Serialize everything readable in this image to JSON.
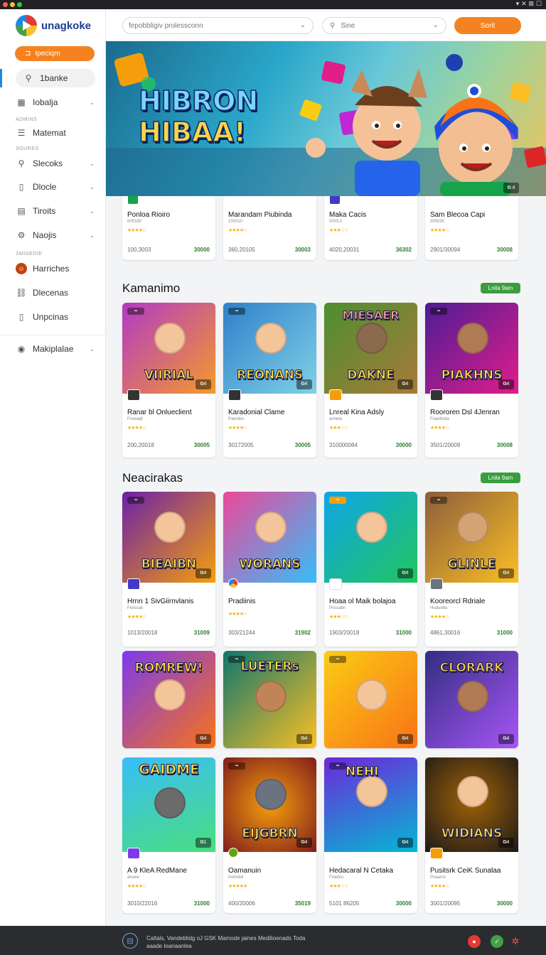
{
  "window": {
    "right_icons": "▾ ✕ ⊠ ☐"
  },
  "app": {
    "name": "unagkoke"
  },
  "sidebar": {
    "cta_label": "Ipeciqm",
    "active_label": "1banke",
    "item_lobalja": "Iobalja",
    "head_admins": "ADMINS",
    "item_matemat": "Matemat",
    "head_sources": "SOURES",
    "item_slecoks": "Slecoks",
    "item_dlocle": "Dlocle",
    "item_tiroits": "Tiroits",
    "item_naojis": "Naojis",
    "head_smisedie": "SMISEDIE",
    "item_harriches": "Harriches",
    "item_dlecenas": "Dlecenas",
    "item_unpcinas": "Unpcinas",
    "item_makiplalae": "Makiplalae"
  },
  "header": {
    "search_placeholder": "fepobbligiv prolessconn",
    "site_placeholder": "Sine",
    "button_label": "Sorit"
  },
  "hero": {
    "title_line1": "HIBRON",
    "title_line2": "HIBAA!",
    "badge": "⧉ 4"
  },
  "row1": [
    {
      "name": "Ponloa Rioiro",
      "sub": "000330",
      "date": "100,3003",
      "price": "30000"
    },
    {
      "name": "Marandam Piubinda",
      "sub": "100310",
      "date": "360,20105",
      "price": "30003"
    },
    {
      "name": "Maka Cacis",
      "sub": "0003,0",
      "date": "4020,20031",
      "price": "36302"
    },
    {
      "name": "Sam Blecoa Capi",
      "sub": "000030",
      "date": "2901/30094",
      "price": "30008"
    }
  ],
  "section1": {
    "title": "Kamanimo",
    "badge": "Lnila 9am"
  },
  "row2": [
    {
      "art": "VIIRIAL",
      "name": "Ranar bl Onlueclient",
      "sub": "Frueaqh",
      "date": "200,20018",
      "price": "30005",
      "c1": "#b23ac6",
      "c2": "#f39a2b"
    },
    {
      "art": "REONANS",
      "name": "Karadonial Clame",
      "sub": "Paerdes",
      "date": "30172005",
      "price": "30005",
      "c1": "#2f80c9",
      "c2": "#7fd1e6"
    },
    {
      "art": "DAKNE",
      "name": "Lnreal Kina Adsly",
      "sub": "annela",
      "date": "310000064",
      "price": "30000",
      "c1": "#4d8f2f",
      "c2": "#a77a3b"
    },
    {
      "art": "PIAKHNS",
      "name": "Roororen Dsl 4Jenran",
      "sub": "Foaelmda",
      "date": "3501/20009",
      "price": "30008",
      "c1": "#4c1d95",
      "c2": "#e11d8a"
    }
  ],
  "section2": {
    "title": "Neacirakas",
    "badge": "Lnila 9am"
  },
  "row3": [
    {
      "art": "BIEAIBN",
      "name": "Hrnn 1 SivGiirnvlanis",
      "sub": "Fiolscak",
      "date": "1013/20018",
      "price": "31009",
      "c1": "#6b21a8",
      "c2": "#f59e0b"
    },
    {
      "art": "WORANS",
      "name": "Pradiinis",
      "sub": "",
      "date": "303/21244",
      "price": "31902",
      "c1": "#ec4899",
      "c2": "#38bdf8"
    },
    {
      "art": "",
      "name": "Hoaa ol Maik bolajoa",
      "sub": "Pnscabn",
      "date": "1903/20018",
      "price": "31000",
      "c1": "#0ea5e9",
      "c2": "#22c55e"
    },
    {
      "art": "GLINLE",
      "name": "Kooreorcl Rdriale",
      "sub": "Huduntla",
      "date": "4861,30016",
      "price": "31000",
      "c1": "#8b5e3c",
      "c2": "#fbbf24"
    }
  ],
  "row4": [
    {
      "art": "ROMREW!",
      "c1": "#7c3aed",
      "c2": "#f97316"
    },
    {
      "art": "LUETERs",
      "c1": "#0f766e",
      "c2": "#fbbf24"
    },
    {
      "art": "",
      "c1": "#facc15",
      "c2": "#f97316"
    },
    {
      "art": "CLORARK",
      "c1": "#312e81",
      "c2": "#a855f7"
    }
  ],
  "row5": [
    {
      "art": "GAIDME",
      "name": "A 9 KleA RedMane",
      "sub": "anuee",
      "date": "3010/22016",
      "price": "31000",
      "c1": "#38bdf8",
      "c2": "#4ade80"
    },
    {
      "art": "EIJGBRN",
      "name": "Oamanuin",
      "sub": "nomolid",
      "date": "400/20006",
      "price": "35019",
      "c1": "#7f1d1d",
      "c2": "#f59e0b"
    },
    {
      "art": "NEHI",
      "name": "Hedacaral N Cetaka",
      "sub": "Foadco",
      "date": "5101 86205",
      "price": "30000",
      "c1": "#6d28d9",
      "c2": "#06b6d4"
    },
    {
      "art": "WIDIANS",
      "name": "Pusitsrk CeiK Sunalaa",
      "sub": "Poaansr",
      "date": "3001/20095",
      "price": "30000",
      "c1": "#1c1917",
      "c2": "#a16207"
    }
  ],
  "footer": {
    "line1": "Caltals, Vandeblidg oJ GSK Mamode jaines  Medilioenads Toda",
    "line2": "aaade loanaanlea",
    "icon": "⊟"
  }
}
